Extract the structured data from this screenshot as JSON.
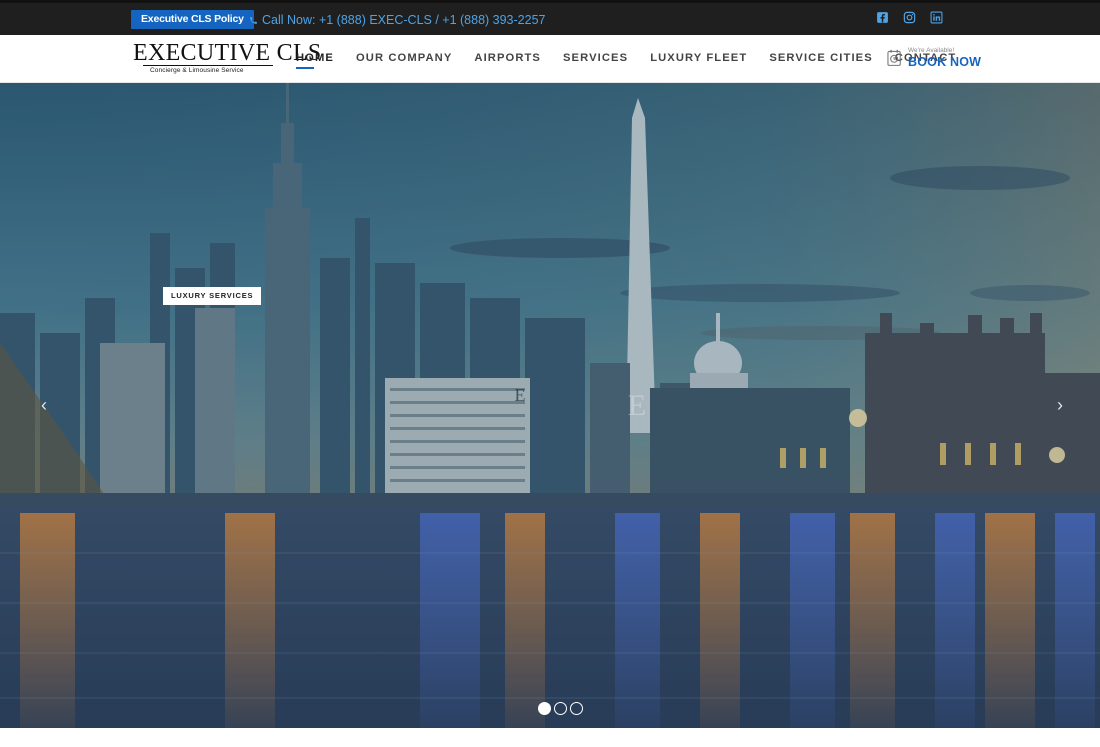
{
  "topbar": {
    "policy_label": "Executive CLS Policy",
    "call_text": "Call Now: +1 (888) EXEC-CLS / +1 (888) 393-2257",
    "socials": [
      "facebook-icon",
      "instagram-icon",
      "linkedin-icon"
    ]
  },
  "logo": {
    "title": "EXECUTIVE CLS",
    "subtitle": "Concierge & Limousine Service"
  },
  "nav": {
    "items": [
      "HOME",
      "OUR COMPANY",
      "AIRPORTS",
      "SERVICES",
      "LUXURY FLEET",
      "SERVICE CITIES",
      "CONTACT"
    ],
    "active": "HOME"
  },
  "book": {
    "small": "We're Available!",
    "big": "BOOK NOW"
  },
  "hero": {
    "badge": "LUXURY SERVICES",
    "slides_total": 3,
    "active_slide": 1,
    "prev_icon": "chevron-left-icon",
    "next_icon": "chevron-right-icon"
  },
  "colors": {
    "accent": "#1565c0",
    "link": "#4da3e6",
    "topbar_bg": "#1f1f1f"
  }
}
